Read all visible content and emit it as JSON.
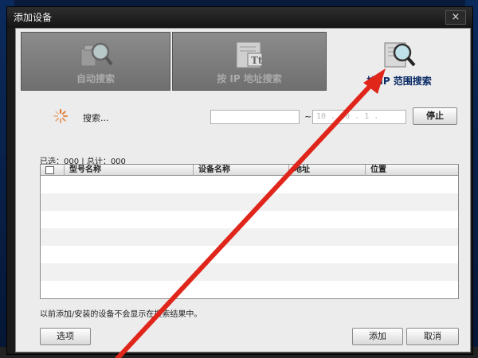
{
  "dialog": {
    "title": "添加设备",
    "close_glyph": "×"
  },
  "tabs": [
    {
      "label": "自动搜索",
      "icon": "magnifier-icon",
      "active": false
    },
    {
      "label": "按 IP 地址搜索",
      "icon": "text-document-icon",
      "active": false
    },
    {
      "label": "按 IP 范围搜索",
      "icon": "scroll-magnifier-icon",
      "active": true
    }
  ],
  "search": {
    "status_text": "搜索...",
    "ip_start": "",
    "ip_end": "10 . 20 . 1 . ",
    "range_separator": "~",
    "stop_label": "停止"
  },
  "table": {
    "count_text": "已选：000 | 总计：000",
    "columns": [
      "型号名称",
      "设备名称",
      "地址",
      "位置"
    ],
    "rows": []
  },
  "footer": {
    "note": "以前添加/安装的设备不会显示在搜索结果中。",
    "options_label": "选项",
    "add_label": "添加",
    "cancel_label": "取消"
  },
  "colors": {
    "annotation_arrow": "#e0261b",
    "active_tab_text": "#0a2a66"
  }
}
